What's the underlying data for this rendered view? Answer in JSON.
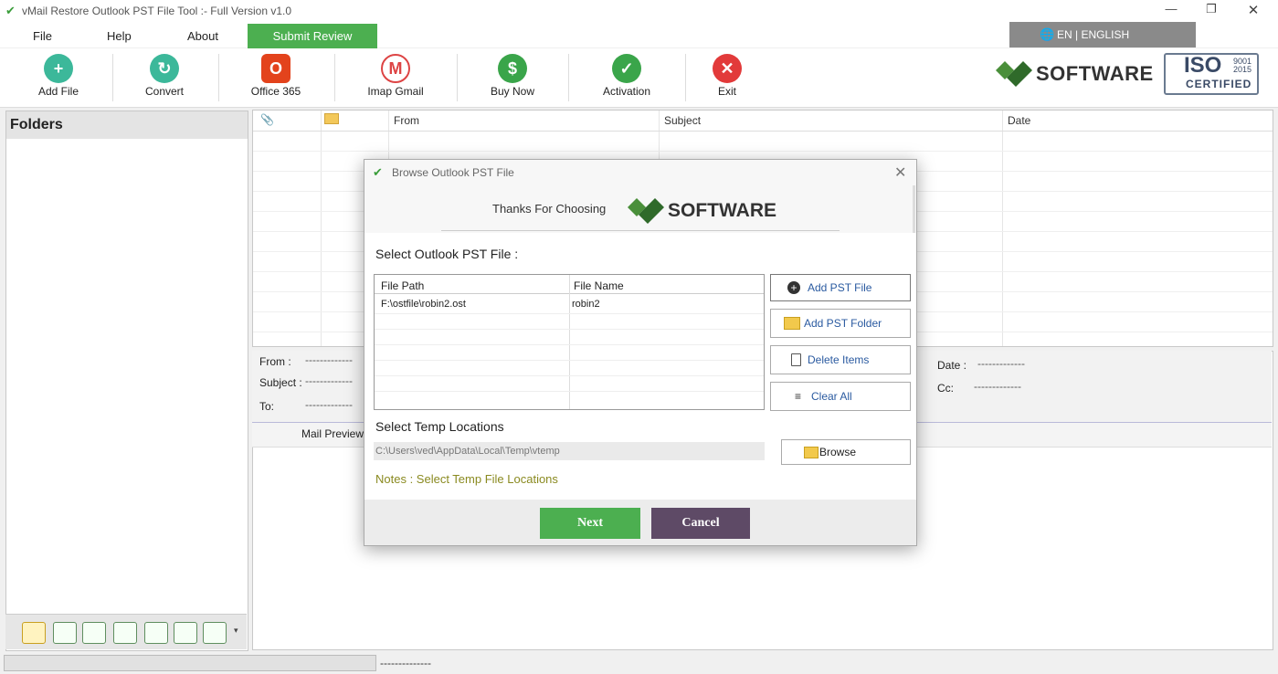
{
  "window": {
    "title": "vMail Restore Outlook PST File Tool :- Full Version v1.0"
  },
  "menu": {
    "file": "File",
    "help": "Help",
    "about": "About",
    "submit_review": "Submit Review",
    "language": "EN | ENGLISH"
  },
  "toolbar": {
    "add_file": "Add File",
    "convert": "Convert",
    "office365": "Office 365",
    "imap_gmail": "Imap Gmail",
    "buy_now": "Buy Now",
    "activation": "Activation",
    "exit": "Exit"
  },
  "brand": {
    "logo_text": "SOFTWARE",
    "iso_line1": "ISO",
    "iso_line2": "9001",
    "iso_line3": "2015",
    "iso_line4": "CERTIFIED"
  },
  "folders": {
    "title": "Folders"
  },
  "grid": {
    "col_from": "From",
    "col_subject": "Subject",
    "col_date": "Date"
  },
  "preview": {
    "from_label": "From :",
    "subject_label": "Subject :",
    "to_label": "To:",
    "date_label": "Date :",
    "cc_label": "Cc:",
    "placeholder": "-------------",
    "tab_mail_preview": "Mail Preview"
  },
  "status": {
    "text": "--------------"
  },
  "dialog": {
    "title": "Browse Outlook PST File",
    "thanks": "Thanks For Choosing",
    "logo_text": "SOFTWARE",
    "select_label": "Select Outlook PST File :",
    "table": {
      "col_path": "File Path",
      "col_name": "File Name",
      "rows": [
        {
          "path": "F:\\ostfile\\robin2.ost",
          "name": "robin2"
        }
      ]
    },
    "add_pst_file": "Add PST File",
    "add_pst_folder": "Add PST Folder",
    "delete_items": "Delete Items",
    "clear_all": "Clear All",
    "temp_label": "Select Temp Locations",
    "temp_path": "C:\\Users\\ved\\AppData\\Local\\Temp\\vtemp",
    "browse": "Browse",
    "notes": "Notes :  Select Temp File Locations",
    "next": "Next",
    "cancel": "Cancel"
  },
  "colors": {
    "accent_green": "#4caf50",
    "cancel_purple": "#5e4a66",
    "notes_olive": "#8a8a20"
  }
}
